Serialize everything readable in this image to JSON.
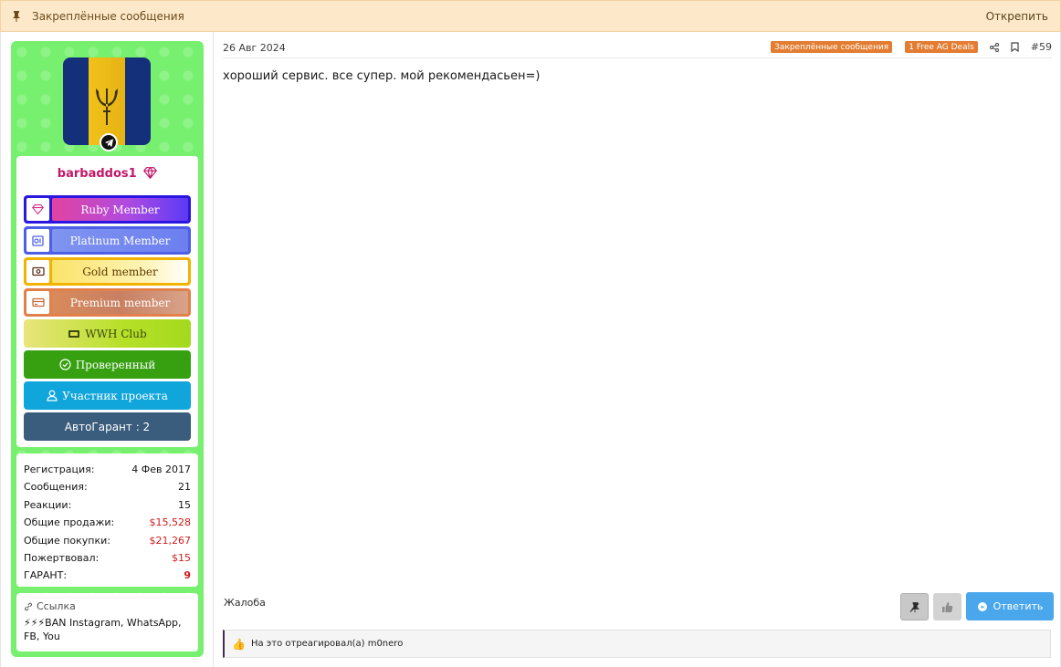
{
  "pinned_bar": {
    "title": "Закреплённые сообщения",
    "unpin_label": "Открепить"
  },
  "user": {
    "username": "barbaddos1",
    "banners": {
      "ruby": "Ruby Member",
      "platinum": "Platinum Member",
      "gold": "Gold member",
      "premium": "Premium member",
      "wwh": "WWH Club",
      "verified": "Проверенный",
      "participant": "Участник проекта",
      "autogarant": "АвтоГарант : 2"
    },
    "stats": [
      {
        "label": "Регистрация:",
        "value": "4 Фев 2017"
      },
      {
        "label": "Сообщения:",
        "value": "21"
      },
      {
        "label": "Реакции:",
        "value": "15"
      },
      {
        "label": "Общие продажи:",
        "value": "$15,528"
      },
      {
        "label": "Общие покупки:",
        "value": "$21,267"
      },
      {
        "label": "Пожертвовал:",
        "value": "$15"
      },
      {
        "label": "ГАРАНТ:",
        "value": "9"
      }
    ],
    "signature": {
      "title": "Ссылка",
      "text": "⚡⚡⚡BAN Instagram, WhatsApp, FB, You"
    }
  },
  "post": {
    "date": "26 Авг 2024",
    "tags": [
      "Закреплённые сообщения",
      "1 Free AG Deals"
    ],
    "number": "#59",
    "message": "хороший сервис. все супер. мой рекомендасьен=)",
    "complain_label": "Жалоба",
    "reply_label": "Ответить",
    "reactions_text": "На это отреагировал(а) m0nero"
  },
  "colors": {
    "sidebar_bg": "#77f06f",
    "username": "#c21868",
    "tag": "#e37d32",
    "reply": "#4aa7ec"
  }
}
